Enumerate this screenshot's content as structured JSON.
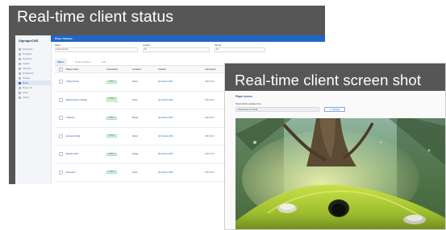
{
  "captions": {
    "status": "Real-time client status",
    "screenshot": "Real-time client screen shot"
  },
  "app": {
    "logo": "SignageCMS",
    "page_title": "Player Settings",
    "nav": [
      "Dashboard",
      "Templates",
      "Schedules",
      "Content",
      "Channels",
      "Publications",
      "Settings",
      "Player",
      "Player info",
      "Group",
      "Activity"
    ],
    "filters": [
      {
        "label": "Status",
        "value": "Select an item"
      },
      {
        "label": "Location",
        "value": "All"
      },
      {
        "label": "Tag key",
        "value": "All"
      }
    ],
    "tabs": [
      "Status",
      "Screen capture",
      "Edit"
    ],
    "columns": [
      "Player name",
      "Connection",
      "Location",
      "Content",
      "Last check"
    ],
    "rows": [
      {
        "name": "Lobby Screen",
        "connection": "Online",
        "note": "",
        "location": "Seoul",
        "content": "[1] Channel-001 ",
        "more": "2021-04-0"
      },
      {
        "name": "Meeting Room Display",
        "connection": "Online",
        "note": "Screen capture",
        "location": "Seoul",
        "content": "[1] Channel-002",
        "more": "2021-04-0"
      },
      {
        "name": "Cafeteria",
        "connection": "Online",
        "note": "",
        "location": "Busan",
        "content": "[2] Channel-003",
        "more": "2021-04-0"
      },
      {
        "name": "Entrance Kiosk",
        "connection": "Online",
        "note": "",
        "location": "Seoul",
        "content": "[1] Channel-004",
        "more": "2021-04-0"
      },
      {
        "name": "Elevator Hall",
        "connection": "Online",
        "note": "",
        "location": "Daegu",
        "content": "[3] Channel-005",
        "more": "2021-04-0"
      },
      {
        "name": "Reception",
        "connection": "Online",
        "note": "",
        "location": "Seoul",
        "content": "[1] Channel-006",
        "more": "2021-04-0"
      }
    ]
  },
  "shot_panel": {
    "player_label": "Player screen",
    "shot_label": "Screenshot update time",
    "shot_time": "2021-04-02 17:12:40",
    "refresh_label": "Refresh"
  },
  "colors": {
    "accent": "#2166c7",
    "caption_bg": "#565656",
    "online": "#2f8b3d"
  },
  "icons": {
    "refresh": "refresh-icon",
    "nav": "nav-icon"
  }
}
